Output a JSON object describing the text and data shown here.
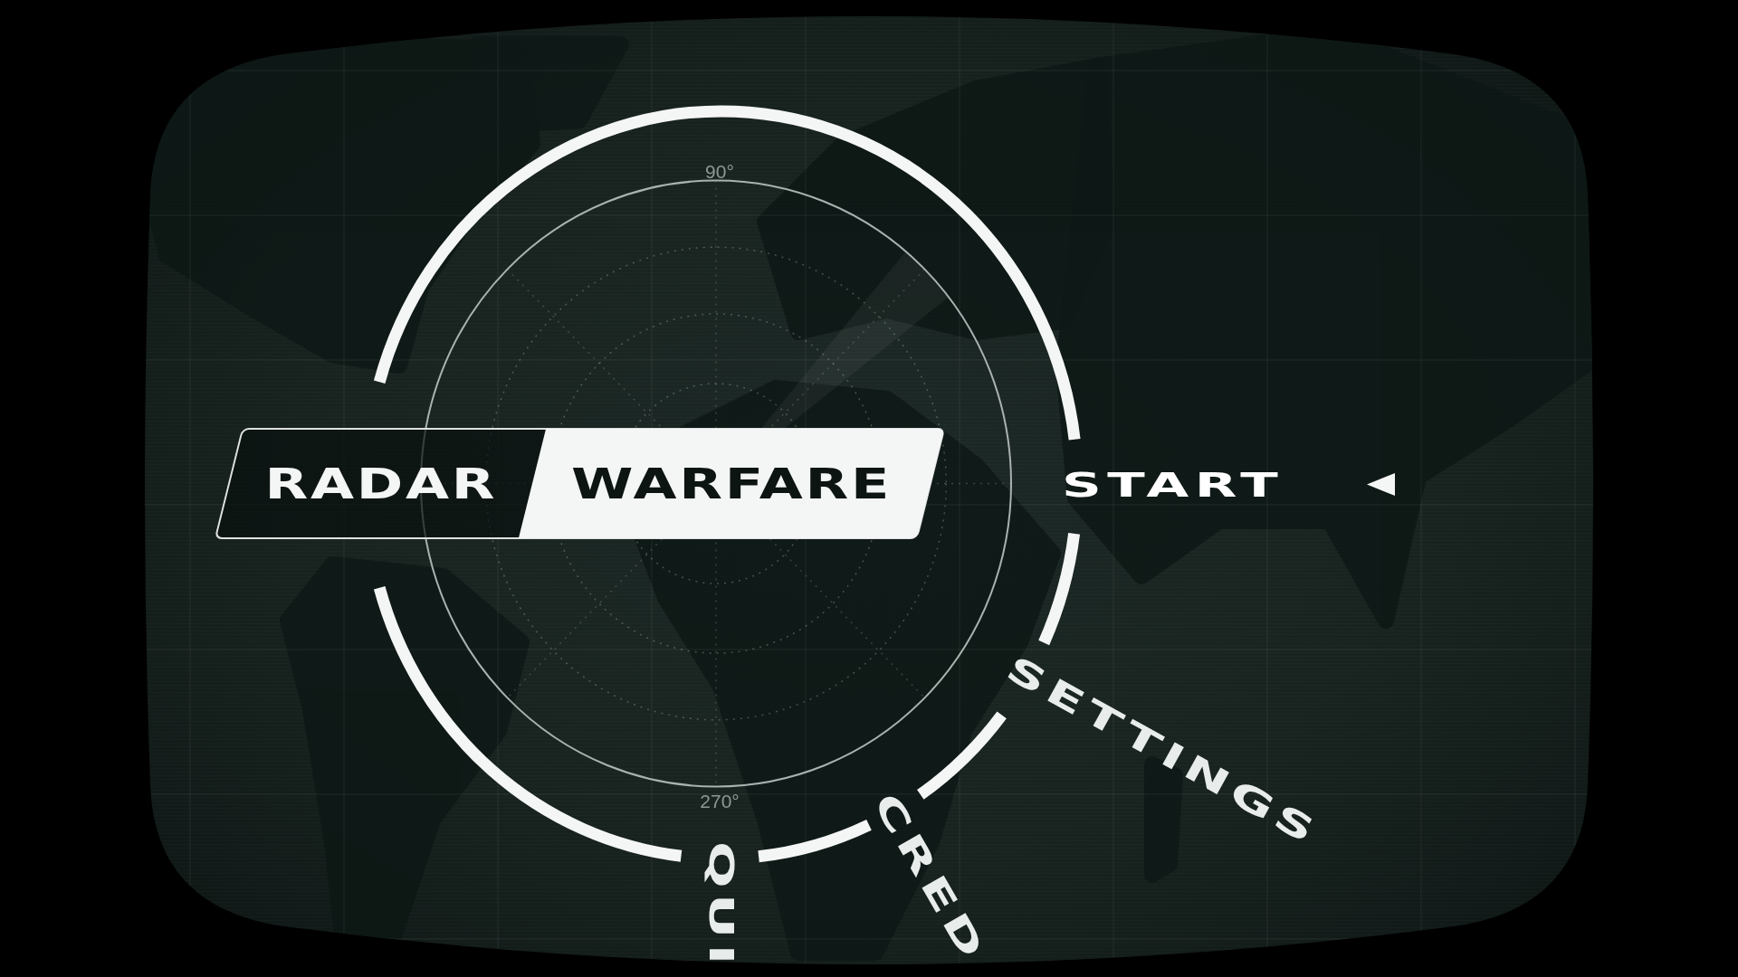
{
  "title": [
    {
      "text": "RADAR",
      "highlighted": false
    },
    {
      "text": "WARFARE",
      "highlighted": true
    }
  ],
  "radar": {
    "scale_labels": [
      "90°",
      "270°"
    ]
  },
  "menu": [
    {
      "label": "START",
      "selected": true
    },
    {
      "label": "SETTINGS",
      "selected": false
    },
    {
      "label": "CRED",
      "selected": false
    },
    {
      "label": "QUI",
      "selected": false
    }
  ]
}
